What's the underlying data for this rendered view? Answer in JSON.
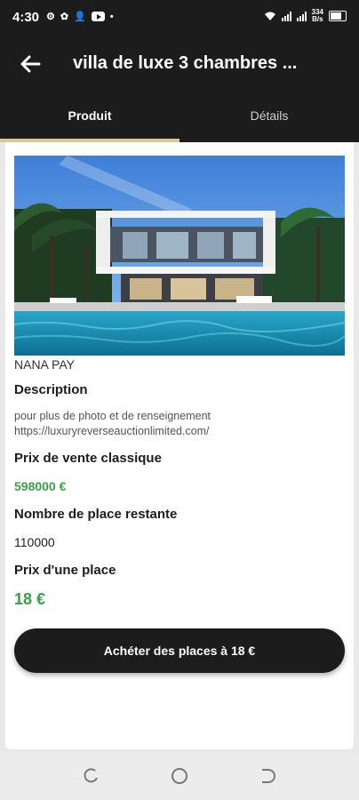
{
  "status_bar": {
    "time": "4:30",
    "net_speed_top": "334",
    "net_speed_bottom": "B/s"
  },
  "app_bar": {
    "title": "villa de luxe 3 chambres ..."
  },
  "tabs": [
    {
      "label": "Produit",
      "active": true
    },
    {
      "label": "Détails",
      "active": false
    }
  ],
  "product": {
    "brand": "NANA PAY",
    "description_label": "Description",
    "description_text": " pour plus de photo et de renseignement",
    "description_link": "https://luxuryreverseauctionlimited.com/",
    "classic_price_label": "Prix de vente classique",
    "classic_price": "598000 €",
    "remaining_label": "Nombre de place restante",
    "remaining": "110000",
    "place_price_label": "Prix d'une place",
    "place_price": "18 €",
    "buy_button": "Achéter des places à 18 €"
  },
  "colors": {
    "dark": "#1c1c1c",
    "green": "#3aa048",
    "accent": "#d9c98f"
  }
}
